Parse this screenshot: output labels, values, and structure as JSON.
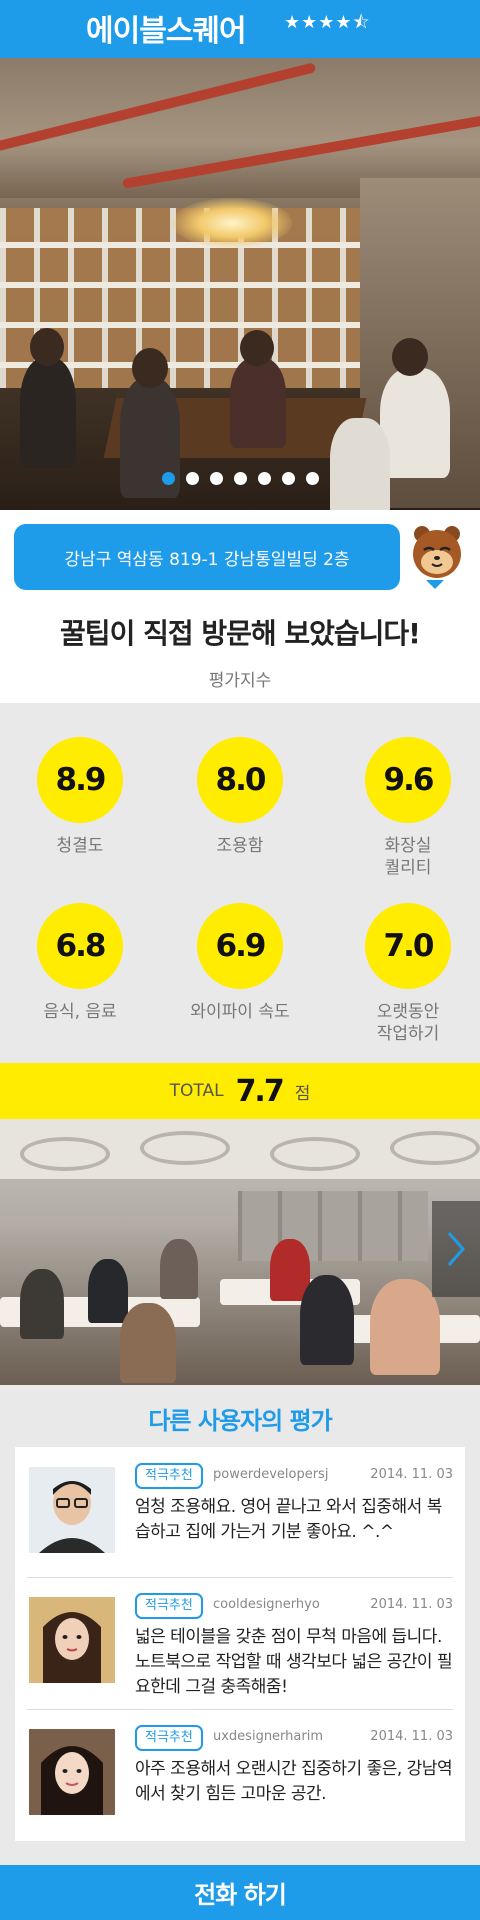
{
  "header": {
    "title": "에이블스퀘어",
    "stars": "★★★★⯪",
    "rating": 4.5,
    "max_rating": 5
  },
  "carousel": {
    "slide_count": 7,
    "active_index": 0
  },
  "address": {
    "text": "강남구 역삼동 819-1 강남통일빌딩 2층"
  },
  "review": {
    "title": "꿀팁이 직접 방문해 보았습니다!",
    "subtitle": "평가지수"
  },
  "scores": [
    {
      "value": "8.9",
      "label": "청결도"
    },
    {
      "value": "8.0",
      "label": "조용함"
    },
    {
      "value": "9.6",
      "label": "화장실\n퀄리티"
    },
    {
      "value": "6.8",
      "label": "음식, 음료"
    },
    {
      "value": "6.9",
      "label": "와이파이 속도"
    },
    {
      "value": "7.0",
      "label": "오랫동안\n작업하기"
    }
  ],
  "total": {
    "label": "TOTAL",
    "value": "7.7",
    "unit": "점"
  },
  "others": {
    "title": "다른 사용자의 평가",
    "items": [
      {
        "badge": "적극추천",
        "user": "powerdevelopersj",
        "date": "2014. 11. 03",
        "text": "엄청 조용해요. 영어 끝나고 와서 집중해서 복습하고 집에 가는거 기분 좋아요. ^.^"
      },
      {
        "badge": "적극추천",
        "user": "cooldesignerhyo",
        "date": "2014. 11. 03",
        "text": "넓은 테이블을 갖춘 점이 무척 마음에 듭니다. 노트북으로 작업할 때 생각보다 넓은 공간이 필요한데 그걸 충족해줌!"
      },
      {
        "badge": "적극추천",
        "user": "uxdesignerharim",
        "date": "2014. 11. 03",
        "text": "아주 조용해서 오랜시간 집중하기 좋은, 강남역에서 찾기 힘든 고마운 공간."
      }
    ]
  },
  "call": {
    "label": "전화 하기"
  },
  "colors": {
    "primary": "#1e9be9",
    "accent": "#ffec00",
    "panel": "#e9e9e9"
  }
}
